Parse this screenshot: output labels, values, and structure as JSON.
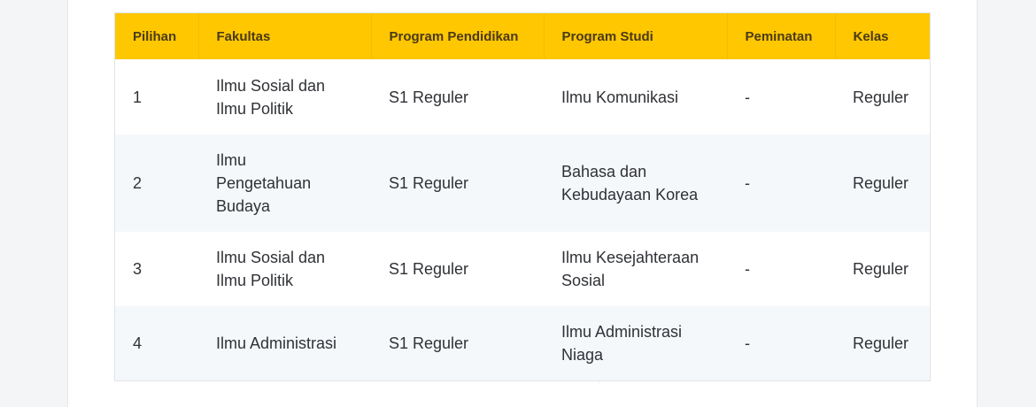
{
  "table": {
    "headers": [
      "Pilihan",
      "Fakultas",
      "Program Pendidikan",
      "Program Studi",
      "Peminatan",
      "Kelas"
    ],
    "rows": [
      [
        "1",
        "Ilmu Sosial dan Ilmu Politik",
        "S1 Reguler",
        "Ilmu Komunikasi",
        "-",
        "Reguler"
      ],
      [
        "2",
        "Ilmu Pengetahuan Budaya",
        "S1 Reguler",
        "Bahasa dan Kebudayaan Korea",
        "-",
        "Reguler"
      ],
      [
        "3",
        "Ilmu Sosial dan Ilmu Politik",
        "S1 Reguler",
        "Ilmu Kesejahteraan Sosial",
        "-",
        "Reguler"
      ],
      [
        "4",
        "Ilmu Administrasi",
        "S1 Reguler",
        "Ilmu Administrasi Niaga",
        "-",
        "Reguler"
      ]
    ]
  },
  "colors": {
    "header_bg": "#ffc700",
    "stripe_bg": "#f5f8fb"
  }
}
